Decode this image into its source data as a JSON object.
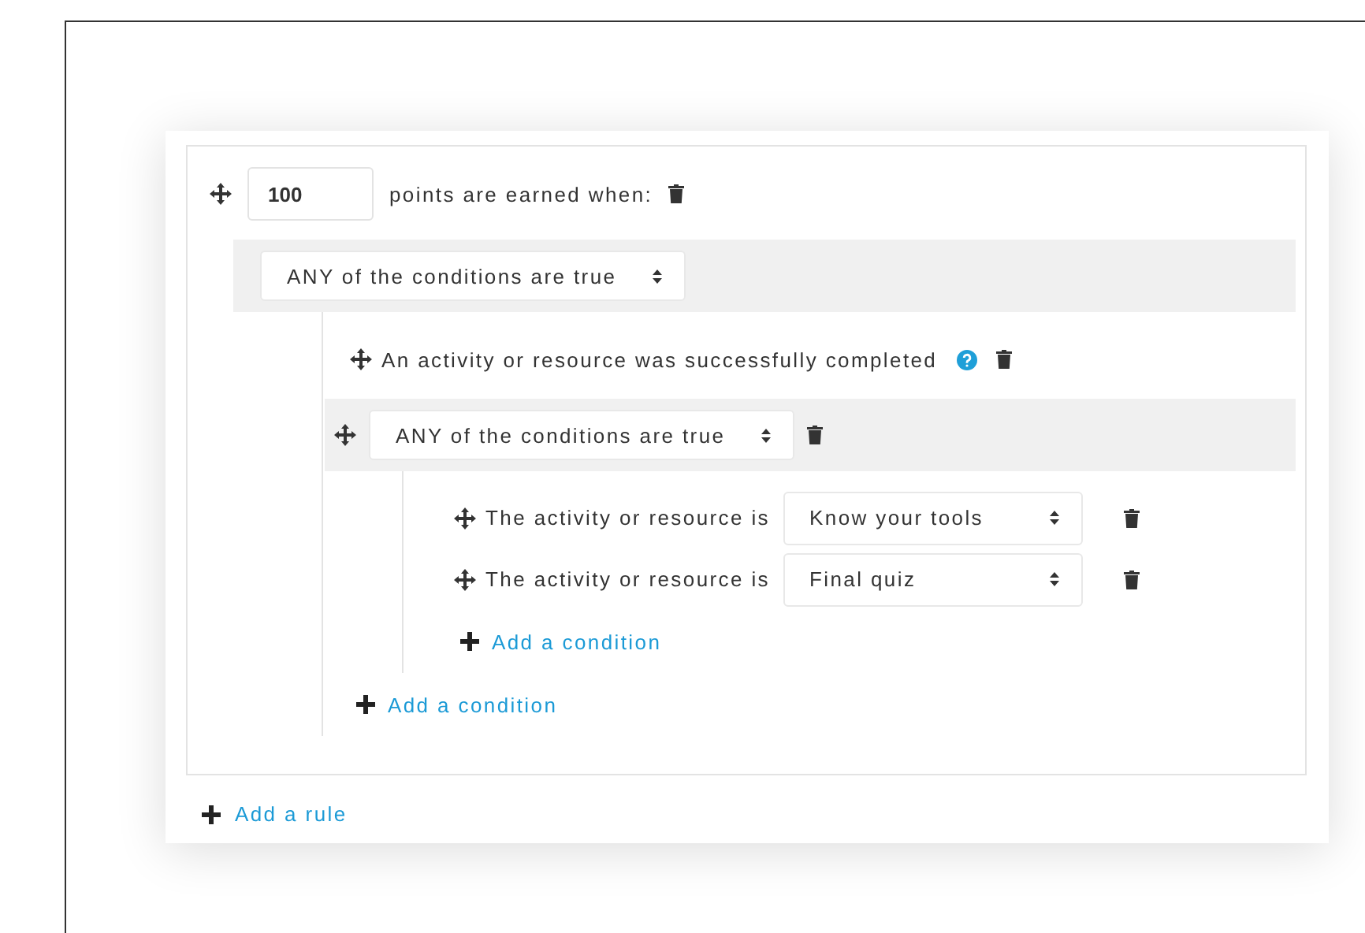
{
  "rule": {
    "points": "100",
    "label": "points are earned when:",
    "set": {
      "operator": "ANY of the conditions are true",
      "add_label": "Add a condition",
      "conditions": [
        {
          "kind": "condition",
          "text": "An activity or resource was successfully completed",
          "help": true
        },
        {
          "kind": "set",
          "operator": "ANY of the conditions are true",
          "add_label": "Add a condition",
          "conditions": [
            {
              "kind": "activity",
              "label": "The activity or resource is",
              "value": "Know your tools"
            },
            {
              "kind": "activity",
              "label": "The activity or resource is",
              "value": "Final quiz"
            }
          ]
        }
      ]
    }
  },
  "add_rule": "Add a rule"
}
